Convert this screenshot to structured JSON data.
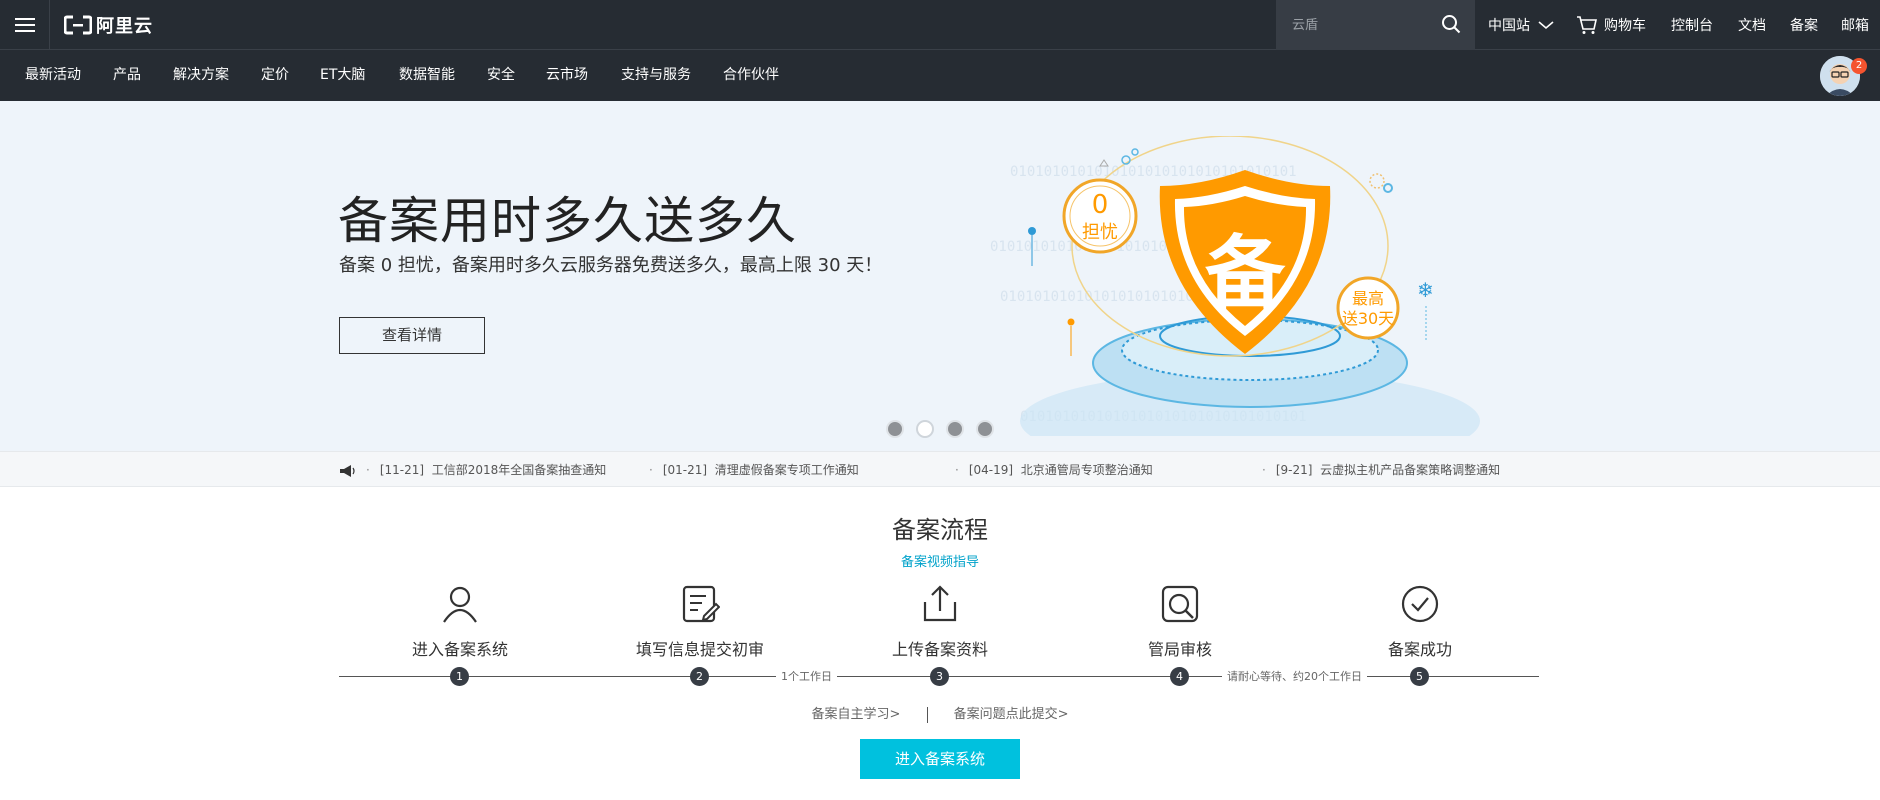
{
  "brand": {
    "logo_text": "阿里云"
  },
  "search": {
    "placeholder": "云盾"
  },
  "topnav": {
    "region": "中国站",
    "cart": "购物车",
    "console": "控制台",
    "docs": "文档",
    "beian": "备案",
    "mail": "邮箱"
  },
  "subnav": {
    "items": [
      "最新活动",
      "产品",
      "解决方案",
      "定价",
      "ET大脑",
      "数据智能",
      "安全",
      "云市场",
      "支持与服务",
      "合作伙伴"
    ]
  },
  "user": {
    "badge_count": "2"
  },
  "banner": {
    "title": "备案用时多久送多久",
    "subtitle": "备案 0 担忧，备案用时多久云服务器免费送多久，最高上限 30 天！",
    "button": "查看详情",
    "graphic": {
      "left_circle_top": "0",
      "left_circle_bottom": "担忧",
      "shield_char": "备",
      "right_circle_top": "最高",
      "right_circle_bottom": "送30天",
      "binary_text": "0101010101010101010101010101010101"
    },
    "carousel": {
      "count": 4,
      "active_index": 1
    }
  },
  "notices": [
    {
      "date": "[11-21]",
      "text": "工信部2018年全国备案抽查通知"
    },
    {
      "date": "[01-21]",
      "text": "清理虚假备案专项工作通知"
    },
    {
      "date": "[04-19]",
      "text": "北京通管局专项整治通知"
    },
    {
      "date": "[9-21]",
      "text": "云虚拟主机产品备案策略调整通知"
    }
  ],
  "process": {
    "title": "备案流程",
    "video_link": "备案视频指导",
    "steps": [
      {
        "num": "1",
        "label": "进入备案系统",
        "icon": "user-icon"
      },
      {
        "num": "2",
        "label": "填写信息提交初审",
        "icon": "form-edit-icon"
      },
      {
        "num": "3",
        "label": "上传备案资料",
        "icon": "upload-icon"
      },
      {
        "num": "4",
        "label": "管局审核",
        "icon": "review-search-icon"
      },
      {
        "num": "5",
        "label": "备案成功",
        "icon": "check-circle-icon"
      }
    ],
    "gap_texts": {
      "between_2_3": "1个工作日",
      "between_4_5": "请耐心等待、约20个工作日"
    },
    "self_study_link": "备案自主学习>",
    "issue_link": "备案问题点此提交>",
    "enter_button": "进入备案系统"
  },
  "colors": {
    "topbar": "#262c33",
    "accent": "#00c1de",
    "orange": "#ff9a00",
    "link": "#00a2ca"
  }
}
